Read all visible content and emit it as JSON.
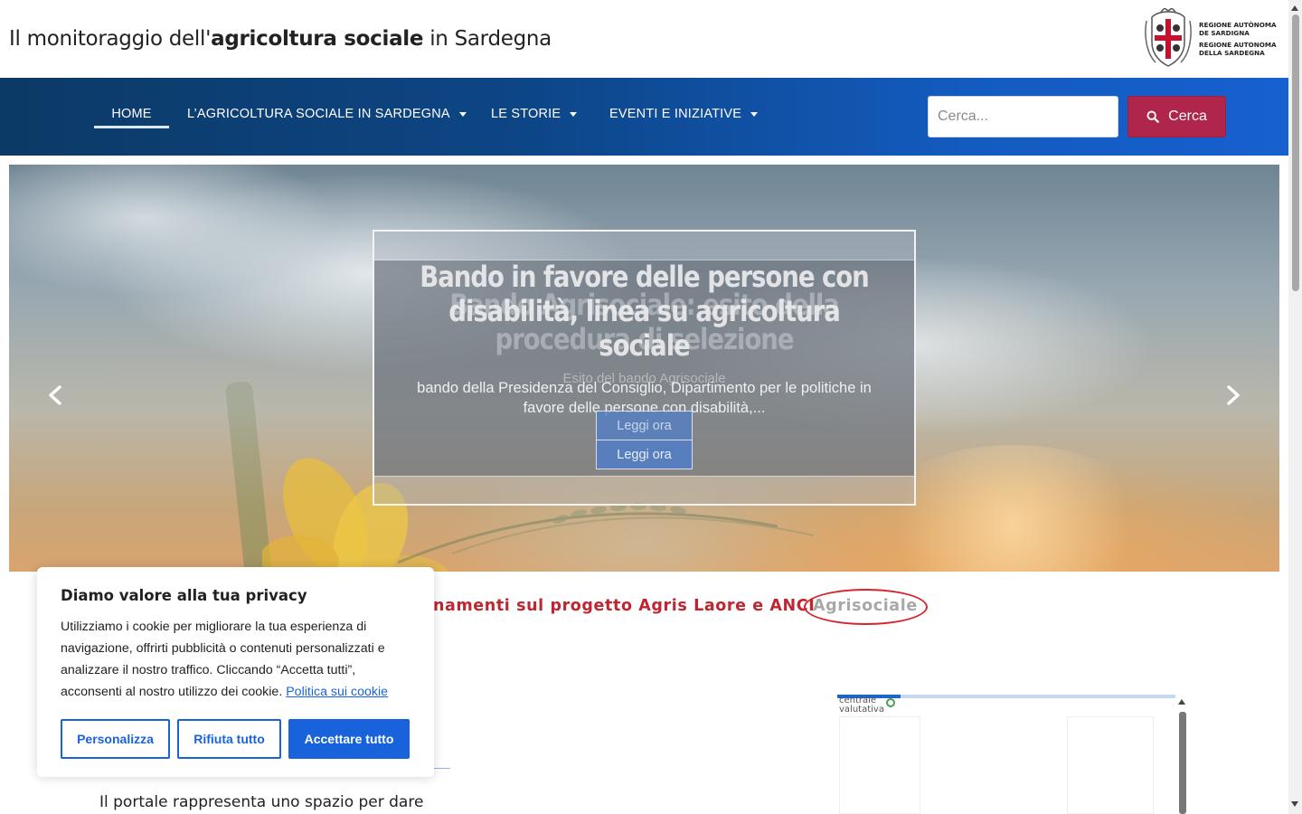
{
  "header": {
    "title_prefix": "Il monitoraggio dell'",
    "title_bold": "agricoltura sociale",
    "title_suffix": " in Sardegna",
    "logo_lines": [
      "REGIONE AUTÒNOMA",
      "DE SARDIGNA",
      "REGIONE AUTONOMA",
      "DELLA SARDEGNA"
    ]
  },
  "nav": {
    "items": [
      {
        "label": "HOME",
        "active": true,
        "has_dropdown": false
      },
      {
        "label": "L’AGRICOLTURA SOCIALE IN SARDEGNA",
        "has_dropdown": true
      },
      {
        "label": "LE STORIE",
        "has_dropdown": true
      },
      {
        "label": "EVENTI E INIZIATIVE",
        "has_dropdown": true
      }
    ],
    "search_placeholder": "Cerca...",
    "search_button": "Cerca",
    "colors": {
      "nav_start": "#0c3a66",
      "nav_end": "#1660d0",
      "search_button": "#b0264a"
    }
  },
  "slider": {
    "slides": [
      {
        "title": "Bando in favore delle persone con disabilità, linea su agricoltura sociale",
        "description": "bando della Presidenza del Consiglio, Dipartimento per le politiche in favore delle persone con disabilità,...",
        "button": "Leggi ora"
      },
      {
        "title": "Bando Agrisociale: esito della procedura di selezione",
        "description": "Esito del bando Agrisociale",
        "button": "Leggi ora"
      }
    ],
    "prev_icon": "chevron-left-icon",
    "next_icon": "chevron-right-icon"
  },
  "announcement": {
    "text": "namenti sul progetto Agris Laore e ANCI",
    "highlight": "Agrisociale",
    "color": "#c0262f"
  },
  "intro": {
    "text": "Il portale rappresenta uno spazio per dare"
  },
  "embed": {
    "label_line1": "centrale",
    "label_line2": "valutativa"
  },
  "cookie_banner": {
    "title": "Diamo valore alla tua privacy",
    "body": "Utilizziamo i cookie per migliorare la tua esperienza di navigazione, offrirti pubblicità o contenuti personalizzati e analizzare il nostro traffico. Cliccando “Accetta tutti”, acconsenti al nostro utilizzo dei cookie.",
    "link": "Politica sui cookie",
    "buttons": {
      "customize": "Personalizza",
      "reject": "Rifiuta tutto",
      "accept": "Accettare tutto"
    },
    "accent": "#1863dc"
  }
}
